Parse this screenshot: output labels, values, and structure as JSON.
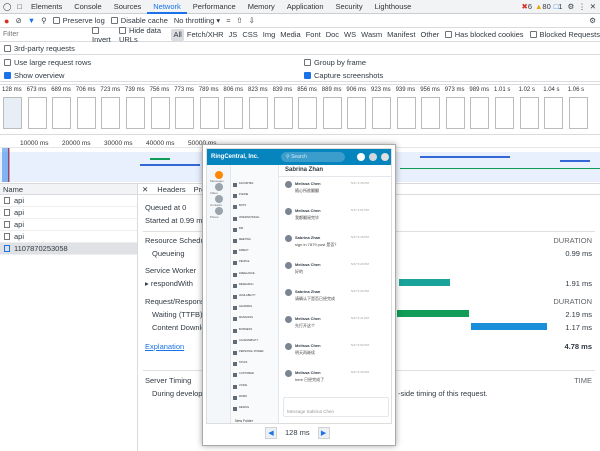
{
  "tabs": [
    "Elements",
    "Console",
    "Sources",
    "Network",
    "Performance",
    "Memory",
    "Application",
    "Security",
    "Lighthouse"
  ],
  "active_tab": "Network",
  "badges": {
    "errors": "6",
    "warnings": "80",
    "messages": "1"
  },
  "toolbar": {
    "preserve_log": "Preserve log",
    "disable_cache": "Disable cache",
    "throttling": "No throttling"
  },
  "filter": {
    "placeholder": "Filter",
    "invert": "Invert",
    "hide_data_urls": "Hide data URLs",
    "types": [
      "All",
      "Fetch/XHR",
      "JS",
      "CSS",
      "Img",
      "Media",
      "Font",
      "Doc",
      "WS",
      "Wasm",
      "Manifest",
      "Other"
    ],
    "blocked_cookies": "Has blocked cookies",
    "blocked_requests": "Blocked Requests",
    "third_party": "3rd-party requests"
  },
  "options": {
    "large_rows": "Use large request rows",
    "show_overview": "Show overview",
    "group_by_frame": "Group by frame",
    "capture_screenshots": "Capture screenshots"
  },
  "filmstrip_times": [
    "128 ms",
    "673 ms",
    "689 ms",
    "706 ms",
    "723 ms",
    "739 ms",
    "756 ms",
    "773 ms",
    "789 ms",
    "806 ms",
    "823 ms",
    "839 ms",
    "856 ms",
    "889 ms",
    "906 ms",
    "923 ms",
    "939 ms",
    "956 ms",
    "973 ms",
    "989 ms",
    "1.01 s",
    "1.02 s",
    "1.04 s",
    "1.06 s"
  ],
  "overview_ticks": [
    "10000 ms",
    "20000 ms",
    "30000 ms",
    "40000 ms",
    "50000 ms"
  ],
  "name_header": "Name",
  "requests": [
    "api",
    "api",
    "api",
    "api",
    "1107870253058"
  ],
  "detail_tabs": [
    "Headers",
    "Previ"
  ],
  "timing": {
    "queued_at": "Queued at 0",
    "started_at": "Started at 0.99 ms",
    "resource_scheduling": "Resource Scheduling",
    "queueing": "Queueing",
    "queueing_val": "0.99 ms",
    "service_worker": "Service Worker",
    "respond_with": "respondWith",
    "respond_with_val": "1.91 ms",
    "request_response": "Request/Response",
    "waiting": "Waiting (TTFB)",
    "waiting_val": "2.19 ms",
    "content_download": "Content Downloa",
    "content_download_val": "1.17 ms",
    "explanation": "Explanation",
    "total": "4.78 ms",
    "duration": "DURATION",
    "server_timing": "Server Timing",
    "time": "TIME",
    "during": "During developm",
    "server_side": "-side timing of this request."
  },
  "screenshot": {
    "app_name": "RingCentral, Inc.",
    "search": "Search",
    "contact": "Sabrina Zhan",
    "compose_placeholder": "Message Sabrina Chen",
    "new_folder": "New Folder",
    "sections": [
      "FAVORITES",
      "PHONE",
      "BOTS",
      "INTERNATIONAL",
      "BIZ",
      "MEETING",
      "DIRECT",
      "PEOPLE",
      "FREELANCE",
      "RESEARCH",
      "AVAILABILITY",
      "LEARNING",
      "MANAGING",
      "BUSINESS",
      "ACCESSIBILITY",
      "PERSONAL POWER",
      "STUFF",
      "CUSTOMER",
      "VOICE",
      "WORK",
      "DESIGN"
    ],
    "messages": [
      {
        "name": "Melissa Chen",
        "time": "5/17 4:45 PM",
        "text": "随心所欲翻翻"
      },
      {
        "name": "Melissa Chen",
        "time": "5/17 4:51 PM",
        "text": "我都翻阅完毕"
      },
      {
        "name": "Sabrina Zhan",
        "time": "5/17 5:18 PM",
        "text": "sign in 7879 post 是否？"
      },
      {
        "name": "Melissa Chen",
        "time": "5/17 5:20 PM",
        "text": "好的"
      },
      {
        "name": "Sabrina Zhan",
        "time": "5/17 5:32 PM",
        "text": "请确认下是否已经完成"
      },
      {
        "name": "Melissa Chen",
        "time": "5/17 5:41 PM",
        "text": "先打开这个"
      },
      {
        "name": "Melissa Chen",
        "time": "5/17 6:02 PM",
        "text": "明天再继续"
      },
      {
        "name": "Melissa Chen",
        "time": "5/17 6:30 PM",
        "text": "here 已经完成了"
      }
    ],
    "nav": [
      "Messages",
      "Video",
      "Contacts",
      "Phone"
    ],
    "zoom": "128 ms"
  }
}
